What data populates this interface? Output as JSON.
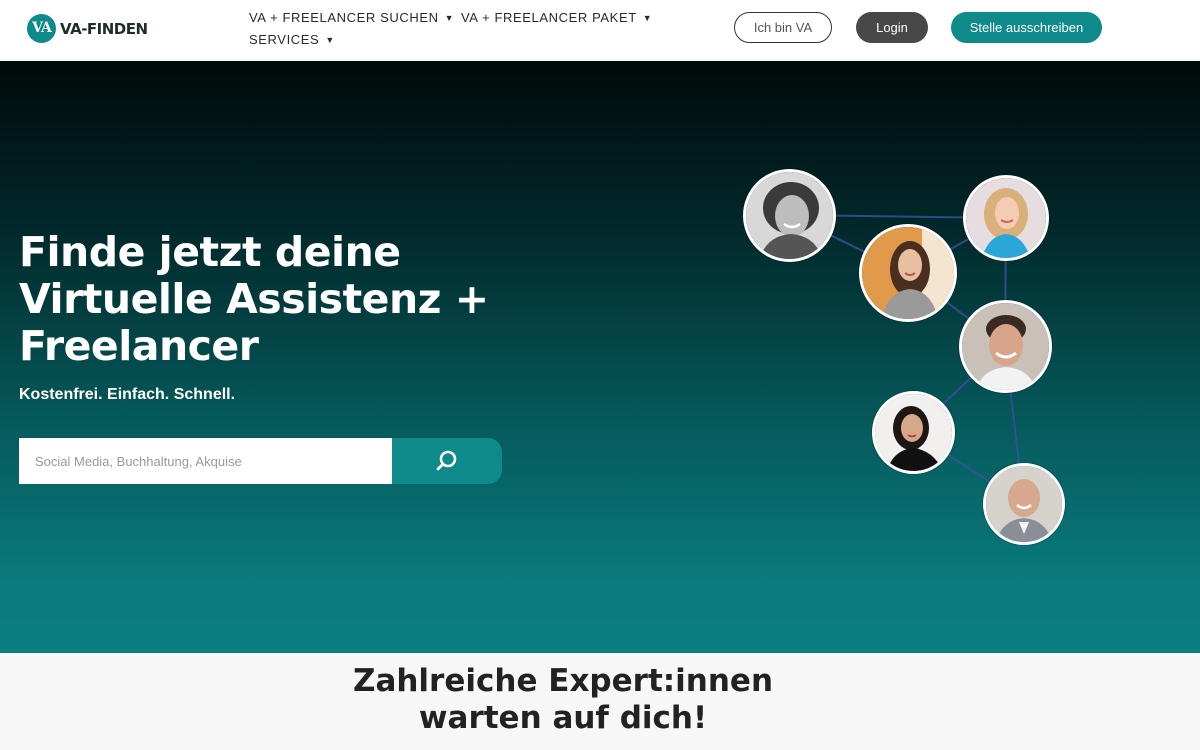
{
  "brand": {
    "logo_mark": "VA",
    "logo_text": "VA-FINDEN",
    "accent": "#0e8a8a"
  },
  "nav": {
    "items": [
      {
        "label": "VA + FREELANCER SUCHEN"
      },
      {
        "label": "VA + FREELANCER PAKET"
      },
      {
        "label": "SERVICES"
      }
    ]
  },
  "actions": {
    "ich_bin_va": "Ich bin VA",
    "login": "Login",
    "stelle": "Stelle ausschreiben"
  },
  "hero": {
    "title_line1": "Finde jetzt deine",
    "title_line2": "Virtuelle Assistenz +",
    "title_line3": "Freelancer",
    "subtitle": "Kostenfrei. Einfach. Schnell.",
    "search_placeholder": "Social Media, Buchhaltung, Akquise",
    "search_icon": "search-icon"
  },
  "experts": {
    "title_line1": "Zahlreiche Expert:innen",
    "title_line2": "warten auf dich!"
  }
}
